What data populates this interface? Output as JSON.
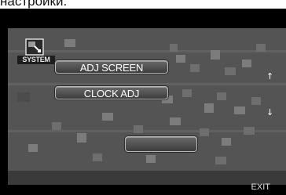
{
  "caption": "настройки.",
  "menu": {
    "section_label": "SYSTEM",
    "section_icon": "system-settings-icon",
    "items": [
      {
        "label": "ADJ SCREEN"
      },
      {
        "label": "CLOCK ADJ"
      }
    ],
    "blank_button_label": ""
  },
  "navigation": {
    "up_icon": "arrow-up-icon",
    "down_icon": "arrow-down-icon",
    "up_glyph": "↑",
    "down_glyph": "↓"
  },
  "footer": {
    "exit_label": "EXIT"
  },
  "colors": {
    "background": "#545454",
    "button_text": "#ffffff"
  }
}
